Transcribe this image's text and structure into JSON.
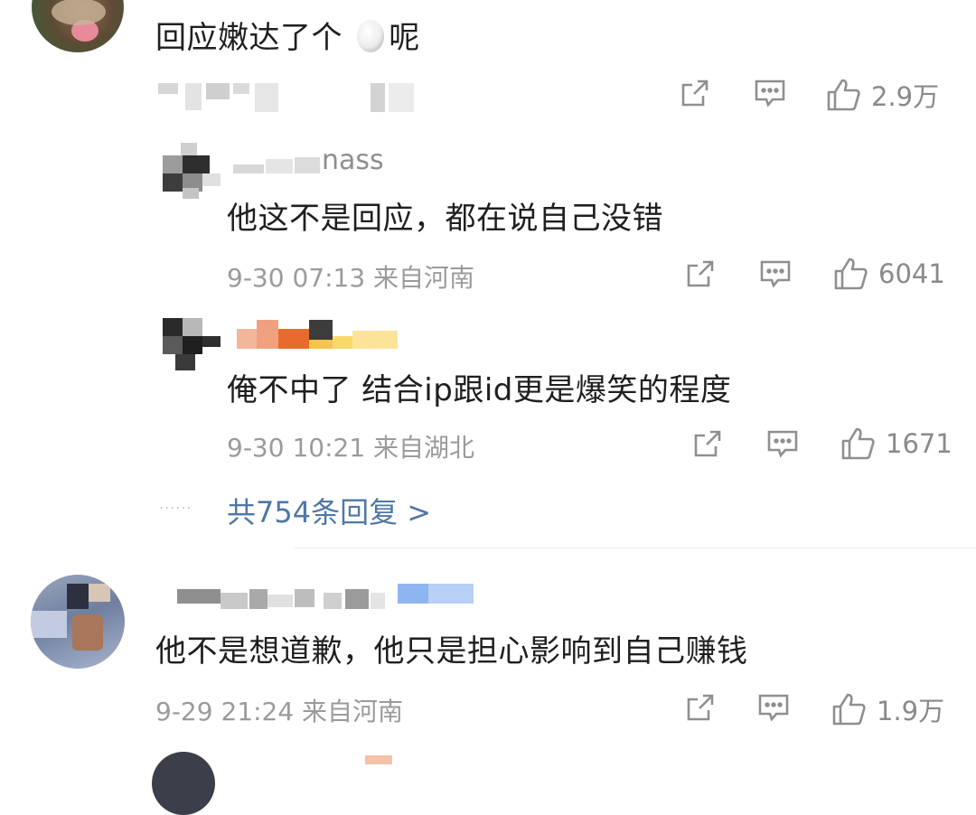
{
  "comments": [
    {
      "text": "回应嫩达了个",
      "text_after_icon": "呢",
      "inline_icon": "egg-emoji",
      "likes": "2.9万"
    },
    {
      "username_suffix": "nass",
      "text": "他这不是回应，都在说自己没错",
      "time": "9-30 07:13",
      "location": "来自河南",
      "likes": "6041"
    },
    {
      "text": "俺不中了 结合ip跟id更是爆笑的程度",
      "time": "9-30 10:21",
      "location": "来自湖北",
      "likes": "1671"
    },
    {
      "text": "他不是想道歉，他只是担心影响到自己赚钱",
      "time": "9-29 21:24",
      "location": "来自河南",
      "likes": "1.9万"
    }
  ],
  "replies_link": "共754条回复 >",
  "dots": "......",
  "icons": {
    "share": "share-square-arrow-icon",
    "comment": "comment-bubble-icon",
    "like": "thumbs-up-icon"
  },
  "colors": {
    "link": "#5077a8",
    "meta": "#9b9b9b",
    "text": "#1f1f1f"
  }
}
